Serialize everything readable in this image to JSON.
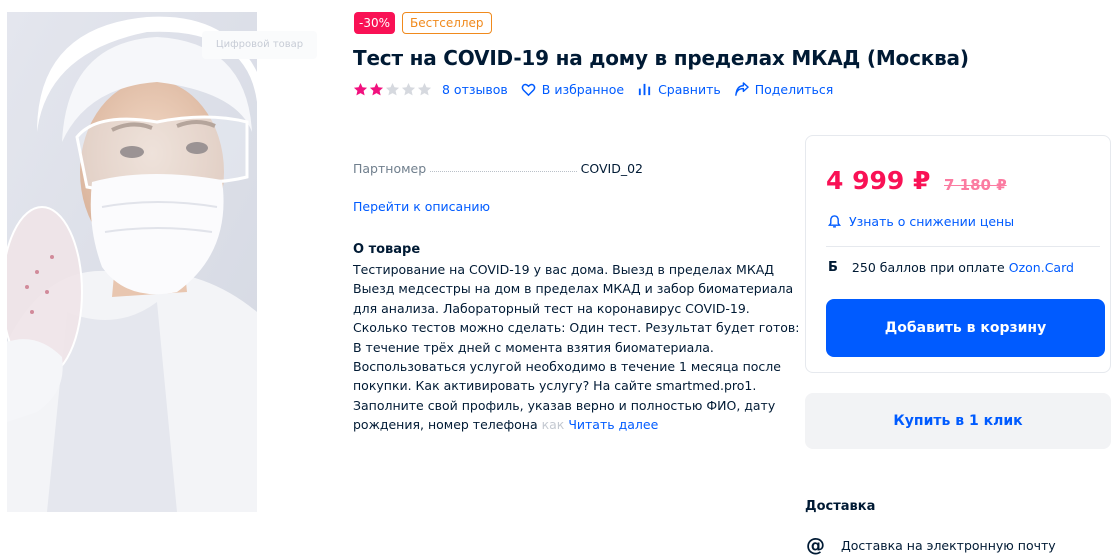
{
  "badges": {
    "discount": "-30%",
    "bestseller": "Бестселлер"
  },
  "product": {
    "title": "Тест на COVID-19 на дому в пределах МКАД (Москва)"
  },
  "image": {
    "digital_chip": "Цифровой товар"
  },
  "meta": {
    "rating": 2,
    "rating_max": 5,
    "reviews": "8 отзывов",
    "favorite": "В избранное",
    "compare": "Сравнить",
    "share": "Поделиться"
  },
  "characteristics": {
    "name": "Партномер",
    "value": "COVID_02"
  },
  "links": {
    "goto_description": "Перейти к описанию"
  },
  "about": {
    "title": "О товаре",
    "lines": [
      "Тестирование на COVID-19 у вас дома. Выезд в пределах МКАД",
      "Выезд медсестры на дом в пределах МКАД и забор биоматериала",
      "для анализа. Лабораторный тест на коронавирус COVID-19.",
      "Сколько тестов можно сделать: Один тест. Результат будет готов:",
      "В течение трёх дней с момента взятия биоматериала.",
      "Воспользоваться услугой необходимо в течение 1 месяца после",
      "покупки. Как активировать услугу? На сайте smartmed.pro1.",
      "Заполните свой профиль, указав верно и полностью ФИО, дату"
    ],
    "last_line_start": "рождения, номер телефона",
    "last_line_fade": " как",
    "read_more": "Читать далее"
  },
  "buybox": {
    "price": "4 999 ₽",
    "old_price": "7 180 ₽",
    "price_alert": "Узнать о снижении цены",
    "bonus_icon": "Б",
    "bonus_text": "250 баллов при оплате",
    "bonus_card": "Ozon.Card",
    "add_to_cart": "Добавить в корзину",
    "buy_one_click": "Купить в 1 клик"
  },
  "delivery": {
    "title": "Доставка",
    "icon": "@",
    "email": "Доставка на электронную почту"
  },
  "colors": {
    "accent": "#005bff",
    "price": "#f91155",
    "badge_best": "#f08a1d",
    "star_filled": "#f1117e",
    "star_empty": "#d6d9df"
  }
}
